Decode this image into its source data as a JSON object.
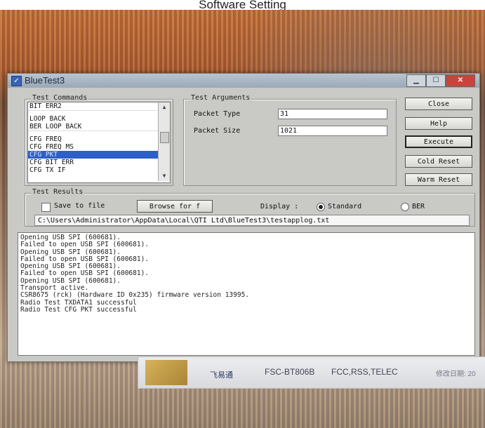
{
  "caption": "Software Setting",
  "window": {
    "title": "BlueTest3"
  },
  "groups": {
    "test_commands": "Test Commands",
    "test_arguments": "Test Arguments",
    "test_results": "Test Results"
  },
  "commands": [
    "BIT ERR2",
    "LOOP BACK",
    "BER LOOP BACK",
    "CFG FREQ",
    "CFG FREQ MS",
    "CFG PKT",
    "CFG BIT ERR",
    "CFG TX IF"
  ],
  "selected_command": "CFG PKT",
  "arguments": {
    "packet_type_label": "Packet Type",
    "packet_type_value": "31",
    "packet_size_label": "Packet Size",
    "packet_size_value": "1021"
  },
  "buttons": {
    "close": "Close",
    "help": "Help",
    "execute": "Execute",
    "cold_reset": "Cold Reset",
    "warm_reset": "Warm Reset",
    "browse": "Browse for f"
  },
  "results": {
    "save_to_file": "Save to file",
    "display_label": "Display :",
    "standard": "Standard",
    "ber": "BER",
    "selected_display": "Standard",
    "path": "C:\\Users\\Administrator\\AppData\\Local\\QTI Ltd\\BlueTest3\\testapplog.txt"
  },
  "log_lines": [
    "Opening USB SPI (600681).",
    "Failed to open USB SPI (600681).",
    "Opening USB SPI (600681).",
    "Failed to open USB SPI (600681).",
    "Opening USB SPI (600681).",
    "Failed to open USB SPI (600681).",
    "Opening USB SPI (600681).",
    "Transport active.",
    "CSR8675 (rck) (Hardware ID 0x235) firmware version 13995.",
    "Radio Test TXDATA1 successful",
    "Radio Test CFG PKT successful"
  ],
  "taskbar": {
    "app_cn": "飞易通",
    "model": "FSC-BT806B",
    "certs": "FCC,RSS,TELEC",
    "date_fragment": "修改日期: 20"
  }
}
